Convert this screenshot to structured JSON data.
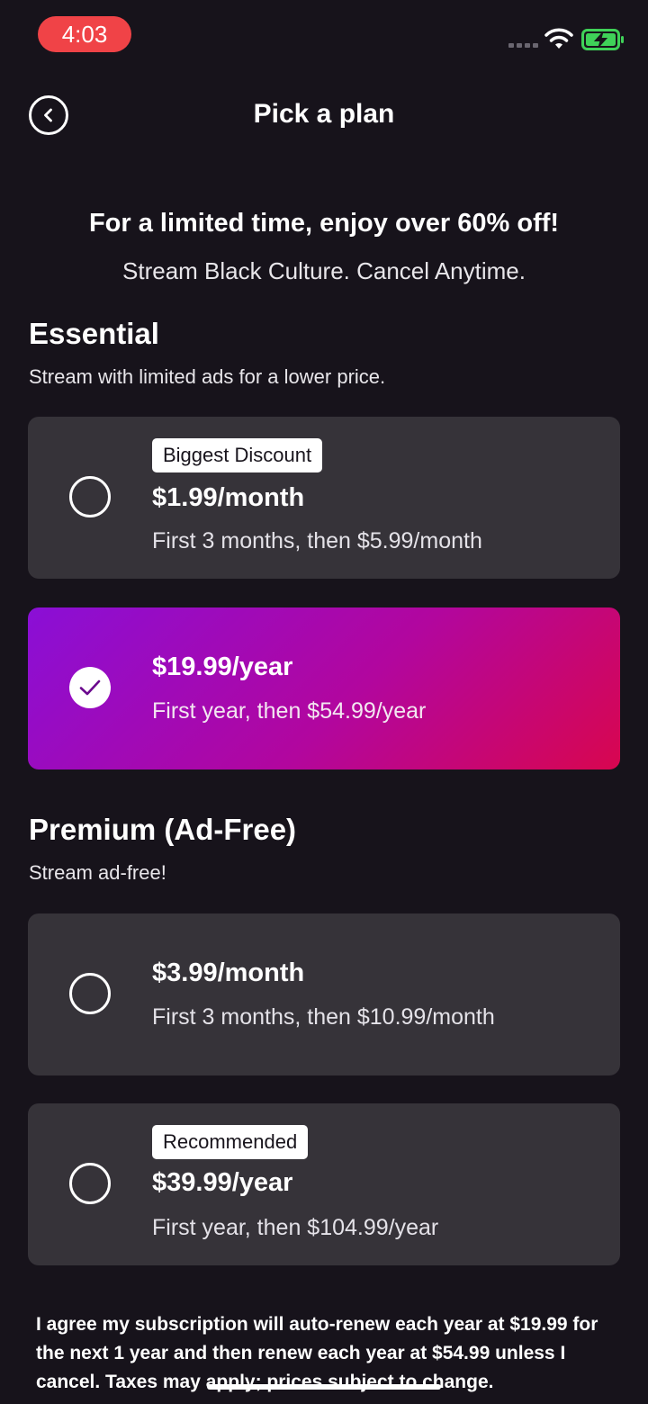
{
  "status": {
    "time": "4:03"
  },
  "header": {
    "title": "Pick a plan"
  },
  "promo": {
    "title": "For a limited time, enjoy over 60% off!",
    "subtitle": "Stream Black Culture. Cancel Anytime."
  },
  "essential": {
    "title": "Essential",
    "subtitle": "Stream with limited ads for a lower price.",
    "monthly": {
      "badge": "Biggest Discount",
      "price": "$1.99/month",
      "detail": "First 3 months, then $5.99/month"
    },
    "yearly": {
      "price": "$19.99/year",
      "detail": "First year, then $54.99/year"
    }
  },
  "premium": {
    "title": "Premium (Ad-Free)",
    "subtitle": "Stream ad-free!",
    "monthly": {
      "price": "$3.99/month",
      "detail": "First 3 months, then $10.99/month"
    },
    "yearly": {
      "badge": "Recommended",
      "price": "$39.99/year",
      "detail": "First year, then $104.99/year"
    }
  },
  "legal": "I agree my subscription will auto-renew each year at $19.99 for the next 1 year and then renew each year at $54.99 unless I cancel. Taxes may apply; prices subject to change.",
  "icons": {
    "back": "chevron-left-icon",
    "check": "checkmark-icon",
    "wifi": "wifi-icon",
    "battery": "battery-charging-icon"
  },
  "colors": {
    "background": "#17131b",
    "card": "#363339",
    "accent_start": "#8a0fd6",
    "accent_end": "#d8064f",
    "status_pill": "#f04347",
    "battery": "#3fd158"
  }
}
